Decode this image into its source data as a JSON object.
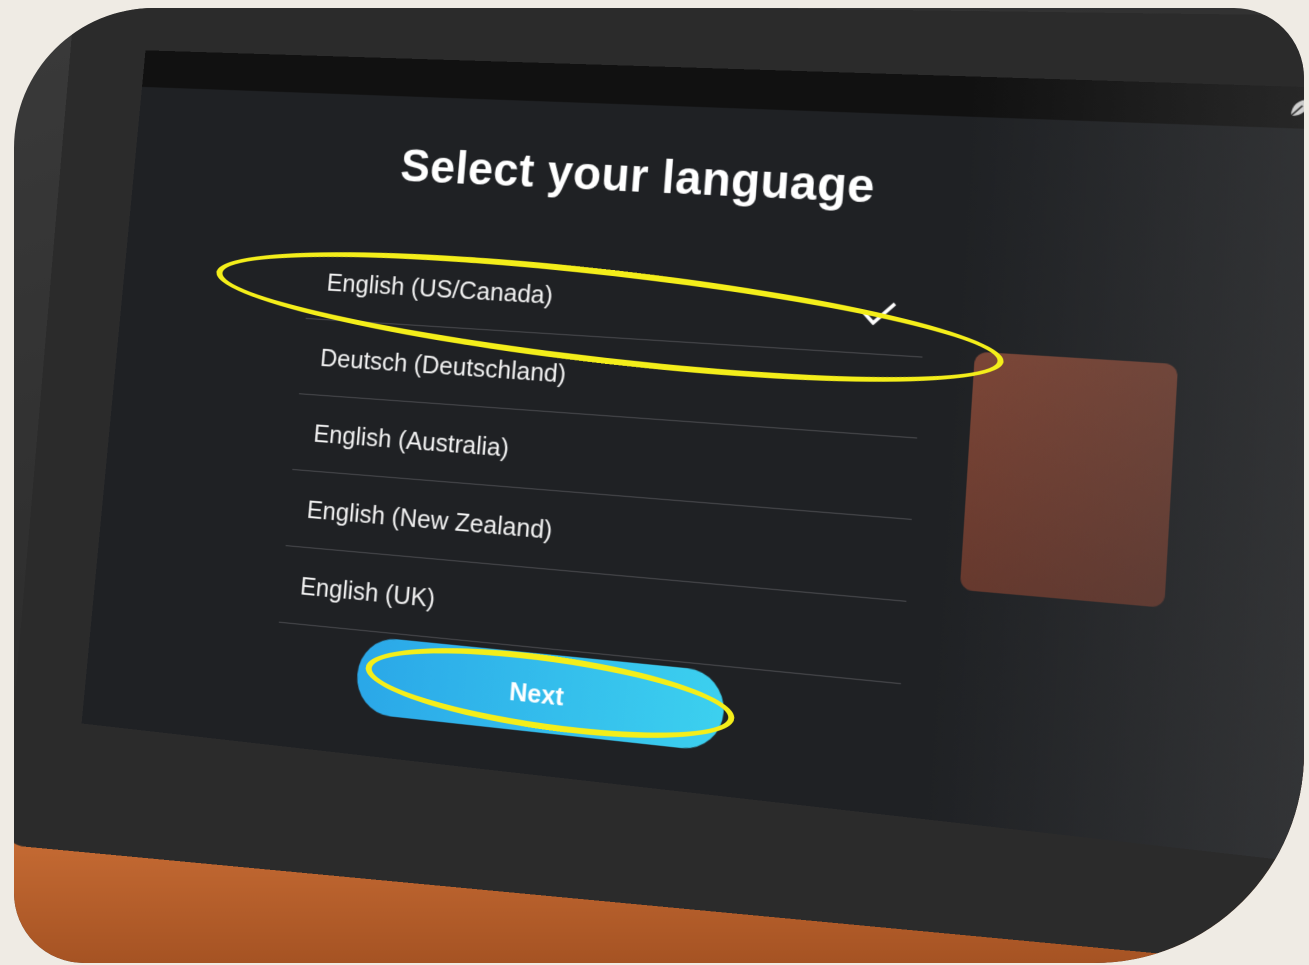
{
  "screen": {
    "title": "Select your language",
    "languages": [
      {
        "label": "English (US/Canada)",
        "selected": true
      },
      {
        "label": "Deutsch (Deutschland)",
        "selected": false
      },
      {
        "label": "English (Australia)",
        "selected": false
      },
      {
        "label": "English (New Zealand)",
        "selected": false
      },
      {
        "label": "English (UK)",
        "selected": false
      }
    ],
    "next_label": "Next"
  },
  "colors": {
    "screen_bg": "#1f2124",
    "button_start": "#2aa7e8",
    "button_end": "#3cd0ef",
    "highlight": "#f4ee1a",
    "text": "#ffffff"
  },
  "icons": {
    "status": "leaf-icon",
    "selected": "check-icon"
  }
}
